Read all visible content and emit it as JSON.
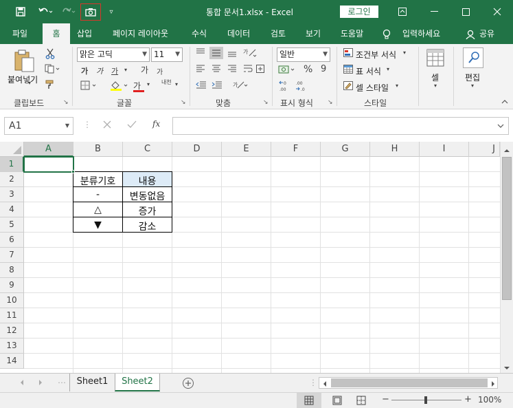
{
  "titlebar": {
    "title": "통합 문서1.xlsx  -  Excel",
    "login": "로그인"
  },
  "tabs": [
    "파일",
    "홈",
    "삽입",
    "페이지 레이아웃",
    "수식",
    "데이터",
    "검토",
    "보기",
    "도움말"
  ],
  "tell_me": "입력하세요",
  "share": "공유",
  "ribbon": {
    "clipboard": {
      "paste": "붙여넣기",
      "label": "클립보드"
    },
    "font": {
      "name": "맑은 고딕",
      "size": "11",
      "label": "글꼴",
      "bold": "가",
      "italic": "가",
      "underline": "가",
      "grow": "가",
      "shrink": "가",
      "color_a": "가",
      "phonetic": "내천"
    },
    "alignment": {
      "label": "맞춤"
    },
    "number": {
      "format": "일반",
      "label": "표시 형식",
      "percent": "%",
      "comma": "9"
    },
    "styles": {
      "conditional": "조건부 서식",
      "table": "표 서식",
      "cell": "셀 스타일",
      "label": "스타일"
    },
    "cells": {
      "label": "셀"
    },
    "editing": {
      "label": "편집"
    }
  },
  "formula_bar": {
    "name_box": "A1",
    "fx": "fx",
    "value": ""
  },
  "grid": {
    "columns": [
      "A",
      "B",
      "C",
      "D",
      "E",
      "F",
      "G",
      "H",
      "I",
      "J"
    ],
    "rows": [
      "1",
      "2",
      "3",
      "4",
      "5",
      "6",
      "7",
      "8",
      "9",
      "10",
      "11",
      "12",
      "13",
      "14"
    ],
    "table": {
      "header": [
        "분류기호",
        "내용"
      ],
      "rows": [
        [
          "-",
          "변동없음"
        ],
        [
          "△",
          "증가"
        ],
        [
          "▼",
          "감소"
        ]
      ]
    }
  },
  "sheets": [
    "Sheet1",
    "Sheet2"
  ],
  "status": {
    "zoom": "100%",
    "minus": "−",
    "plus": "+"
  },
  "colors": {
    "brand": "#217346",
    "header_fill": "#ddebf7"
  }
}
